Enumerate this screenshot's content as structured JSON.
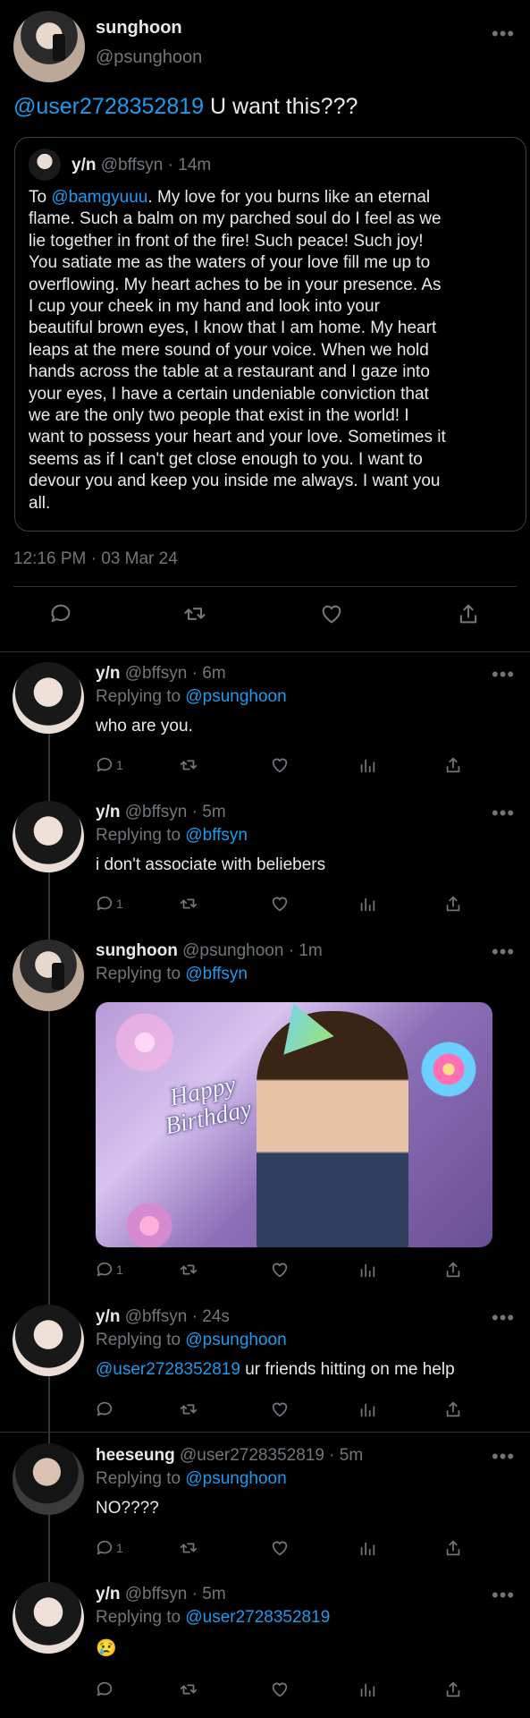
{
  "colors": {
    "background": "#000000",
    "text": "#e7e9ea",
    "muted": "#71767b",
    "link": "#1d9bf0",
    "divider": "#2f3336"
  },
  "main_tweet": {
    "display_name": "sunghoon",
    "handle": "@psunghoon",
    "mention": "@user2728352819",
    "text": " U want this???",
    "timestamp": "12:16 PM · 03 Mar 24",
    "quote": {
      "display_name": "y/n",
      "handle": "@bffsyn",
      "time": "· 14m",
      "prefix": "To ",
      "mention": "@bamgyuuu",
      "body_lines": [
        ". My love for you burns like an eternal",
        "flame. Such a balm on my parched soul do I feel as we",
        "lie together in front of the fire! Such peace! Such joy!",
        "You satiate me as the waters of your love fill me up to",
        "overflowing. My heart aches to be in your presence. As",
        "I cup your cheek in my hand and look into your",
        "beautiful brown eyes, I know that I am home. My heart",
        "leaps at the mere sound of your voice. When we hold",
        "hands across the table at a restaurant and I gaze into",
        "your eyes, I have a certain undeniable conviction that",
        "we are the only two people that exist in the world! I",
        "want to possess your heart and your love. Sometimes it",
        "seems as if I can't get close enough to you. I want to",
        "devour you and keep you inside me always. I want you",
        "all."
      ]
    }
  },
  "replies": [
    {
      "display_name": "y/n",
      "meta": "@bffsyn · 6m",
      "replying_label": "Replying to",
      "replying_to": "@psunghoon",
      "mention": "",
      "text": "who are you.",
      "reply_count": "1"
    },
    {
      "display_name": "y/n",
      "meta": "@bffsyn · 5m",
      "replying_label": "Replying to",
      "replying_to": "@bffsyn",
      "mention": "",
      "text": "i don't associate with beliebers",
      "reply_count": "1"
    },
    {
      "display_name": "sunghoon",
      "meta": "@psunghoon · 1m",
      "replying_label": "Replying to",
      "replying_to": "@bffsyn",
      "mention": "",
      "text": "",
      "reply_count": "1",
      "image": {
        "caption_line1": "Happy",
        "caption_line2": "Birthday"
      }
    },
    {
      "display_name": "y/n",
      "meta": "@bffsyn · 24s",
      "replying_label": "Replying to",
      "replying_to": "@psunghoon",
      "mention": "@user2728352819",
      "text": " ur friends hitting on me help",
      "reply_count": ""
    },
    {
      "display_name": "heeseung",
      "meta": "@user2728352819 · 5m",
      "replying_label": "Replying to",
      "replying_to": "@psunghoon",
      "mention": "",
      "text": "NO????",
      "reply_count": "1"
    },
    {
      "display_name": "y/n",
      "meta": "@bffsyn · 5m",
      "replying_label": "Replying to",
      "replying_to": "@user2728352819",
      "mention": "",
      "text": "😢",
      "reply_count": ""
    }
  ],
  "icons": [
    "reply-icon",
    "retweet-icon",
    "like-icon",
    "views-icon",
    "share-icon",
    "more-icon"
  ]
}
